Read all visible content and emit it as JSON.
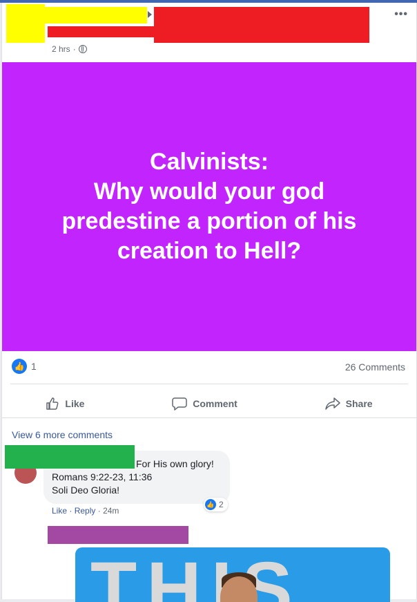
{
  "post": {
    "time": "2 hrs",
    "privacy_icon": "globe-icon",
    "more_icon": "ellipsis-icon",
    "image_text_lines": [
      "Calvinists:",
      "Why would your god",
      "predestine a portion of his",
      "creation to Hell?"
    ],
    "image_bg": "#c124fd"
  },
  "stats": {
    "likes": "1",
    "comments": "26 Comments"
  },
  "actions": {
    "like": "Like",
    "comment": "Comment",
    "share": "Share"
  },
  "comments_section": {
    "view_more": "View 6 more comments",
    "comment": {
      "line1": "For His own glory!",
      "line2": "Romans 9:22-23, 11:36",
      "line3": "Soli Deo Gloria!",
      "reaction_count": "2",
      "like_label": "Like",
      "reply_label": "Reply",
      "time": "24m"
    },
    "gif_text": "THIS"
  },
  "colors": {
    "accent": "#1877f2",
    "link": "#385898",
    "redact_yellow": "#ffff00",
    "redact_red": "#ee1d23",
    "redact_green": "#22b14c",
    "redact_purple": "#a349a4"
  }
}
